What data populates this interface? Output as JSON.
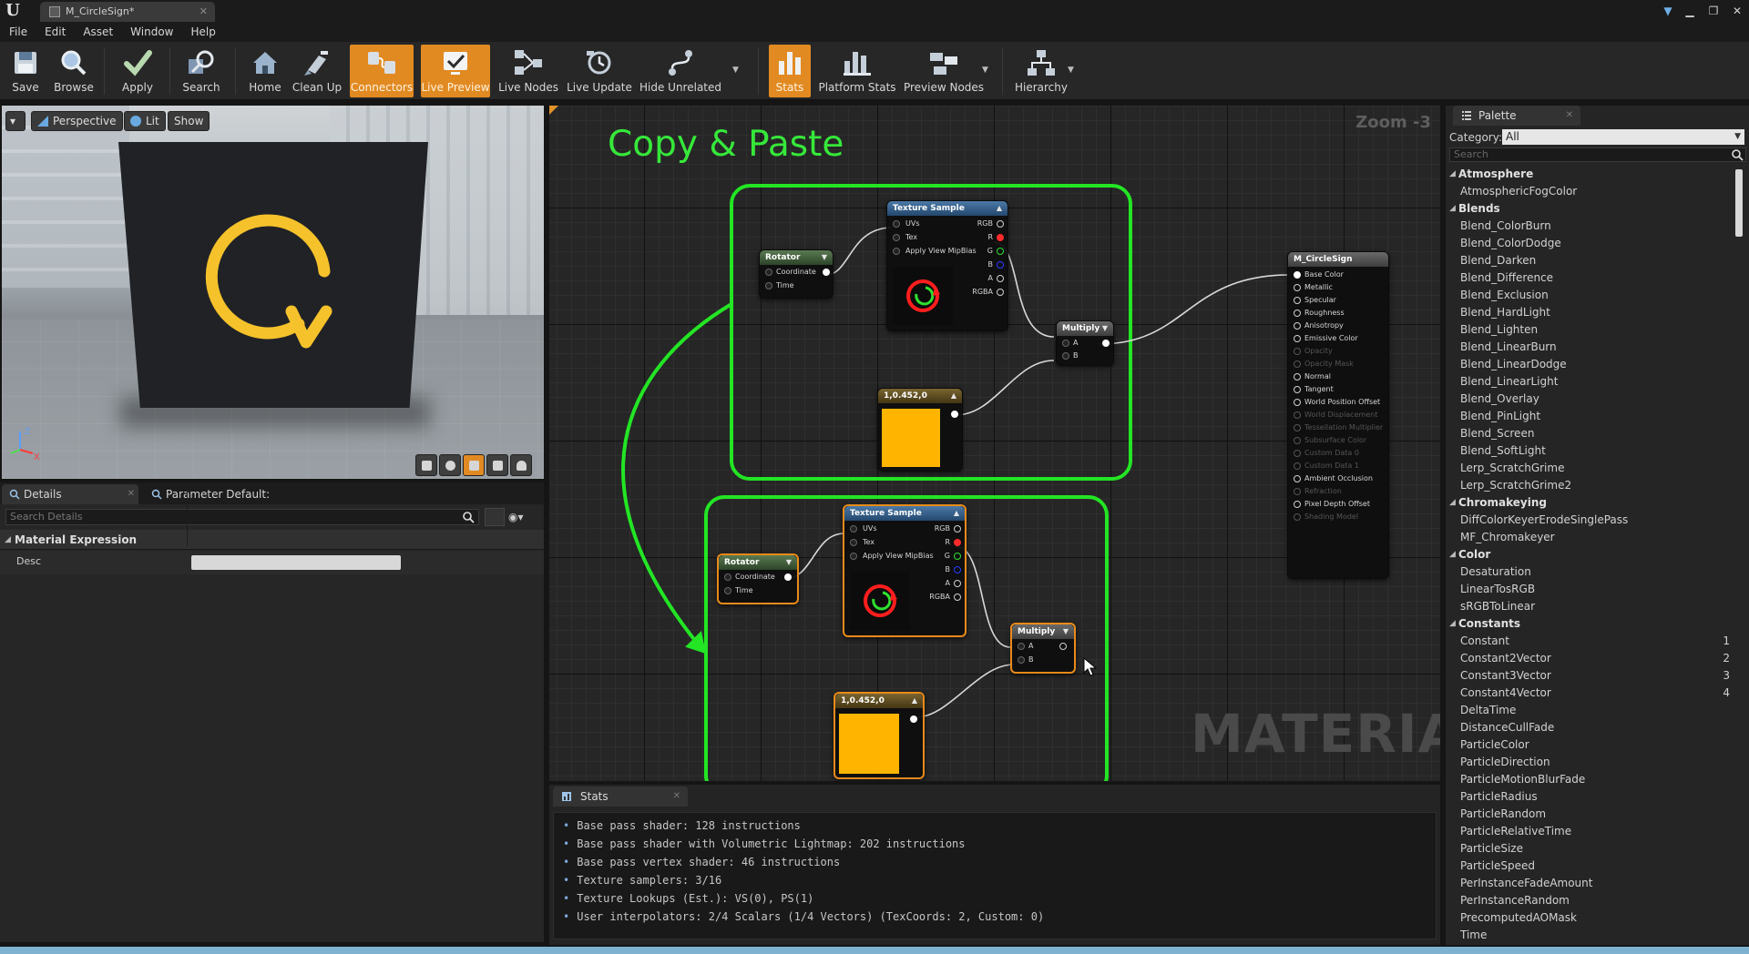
{
  "window": {
    "tab_title": "M_CircleSign*",
    "controls": [
      "minimize",
      "restore",
      "close"
    ]
  },
  "menu": [
    "File",
    "Edit",
    "Asset",
    "Window",
    "Help"
  ],
  "toolbar": {
    "buttons": [
      {
        "label": "Save",
        "icon": "save-icon",
        "active": false
      },
      {
        "label": "Browse",
        "icon": "browse-icon",
        "active": false
      },
      {
        "label": "Apply",
        "icon": "apply-check-icon",
        "active": false
      },
      {
        "label": "Search",
        "icon": "search-icon",
        "active": false
      },
      {
        "label": "Home",
        "icon": "home-icon",
        "active": false
      },
      {
        "label": "Clean Up",
        "icon": "clean-up-icon",
        "active": false
      },
      {
        "label": "Connectors",
        "icon": "connectors-icon",
        "active": true
      },
      {
        "label": "Live Preview",
        "icon": "live-preview-icon",
        "active": true
      },
      {
        "label": "Live Nodes",
        "icon": "live-nodes-icon",
        "active": false
      },
      {
        "label": "Live Update",
        "icon": "live-update-icon",
        "active": false
      },
      {
        "label": "Hide Unrelated",
        "icon": "hide-unrelated-icon",
        "active": false
      },
      {
        "label": "Stats",
        "icon": "stats-icon",
        "active": true
      },
      {
        "label": "Platform Stats",
        "icon": "platform-stats-icon",
        "active": false
      },
      {
        "label": "Preview Nodes",
        "icon": "preview-nodes-icon",
        "active": false
      },
      {
        "label": "Hierarchy",
        "icon": "hierarchy-icon",
        "active": false
      }
    ]
  },
  "viewport": {
    "view_mode": "Perspective",
    "lighting": "Lit",
    "show": "Show",
    "axis_labels": {
      "z": "Z",
      "x": "X"
    }
  },
  "details": {
    "tabs": [
      {
        "label": "Details"
      },
      {
        "label": "Parameter Default:"
      }
    ],
    "search_placeholder": "Search Details",
    "category": "Material Expression",
    "desc_label": "Desc",
    "desc_value": ""
  },
  "graph": {
    "zoom": "Zoom -3",
    "title": "Copy & Paste",
    "watermark": "MATERIAL",
    "texture_sample": {
      "title": "Texture Sample",
      "inputs": [
        "UVs",
        "Tex",
        "Apply View MipBias"
      ],
      "outputs": [
        "RGB",
        "R",
        "G",
        "B",
        "A",
        "RGBA"
      ]
    },
    "rotator": {
      "title": "Rotator",
      "inputs": [
        "Coordinate",
        "Time"
      ]
    },
    "multiply": {
      "title": "Multiply",
      "inputs": [
        "A",
        "B"
      ]
    },
    "constant": {
      "title": "1,0.452,0",
      "color": "#ffb400"
    },
    "result": {
      "title": "M_CircleSign",
      "pins": [
        {
          "label": "Base Color",
          "enabled": true
        },
        {
          "label": "Metallic",
          "enabled": true
        },
        {
          "label": "Specular",
          "enabled": true
        },
        {
          "label": "Roughness",
          "enabled": true
        },
        {
          "label": "Anisotropy",
          "enabled": true
        },
        {
          "label": "Emissive Color",
          "enabled": true
        },
        {
          "label": "Opacity",
          "enabled": false
        },
        {
          "label": "Opacity Mask",
          "enabled": false
        },
        {
          "label": "Normal",
          "enabled": true
        },
        {
          "label": "Tangent",
          "enabled": true
        },
        {
          "label": "World Position Offset",
          "enabled": true
        },
        {
          "label": "World Displacement",
          "enabled": false
        },
        {
          "label": "Tessellation Multiplier",
          "enabled": false
        },
        {
          "label": "Subsurface Color",
          "enabled": false
        },
        {
          "label": "Custom Data 0",
          "enabled": false
        },
        {
          "label": "Custom Data 1",
          "enabled": false
        },
        {
          "label": "Ambient Occlusion",
          "enabled": true
        },
        {
          "label": "Refraction",
          "enabled": false
        },
        {
          "label": "Pixel Depth Offset",
          "enabled": true
        },
        {
          "label": "Shading Model",
          "enabled": false
        }
      ]
    }
  },
  "stats": {
    "tab_label": "Stats",
    "lines": [
      "Base pass shader: 128 instructions",
      "Base pass shader with Volumetric Lightmap: 202 instructions",
      "Base pass vertex shader: 46 instructions",
      "Texture samplers: 3/16",
      "Texture Lookups (Est.): VS(0), PS(1)",
      "User interpolators: 2/4 Scalars (1/4 Vectors) (TexCoords: 2, Custom: 0)"
    ]
  },
  "palette": {
    "tab_label": "Palette",
    "category_label": "Category:",
    "category_value": "All",
    "search_placeholder": "Search",
    "rows": [
      {
        "type": "cat",
        "label": "Atmosphere"
      },
      {
        "type": "item",
        "label": "AtmosphericFogColor"
      },
      {
        "type": "cat",
        "label": "Blends"
      },
      {
        "type": "item",
        "label": "Blend_ColorBurn"
      },
      {
        "type": "item",
        "label": "Blend_ColorDodge"
      },
      {
        "type": "item",
        "label": "Blend_Darken"
      },
      {
        "type": "item",
        "label": "Blend_Difference"
      },
      {
        "type": "item",
        "label": "Blend_Exclusion"
      },
      {
        "type": "item",
        "label": "Blend_HardLight"
      },
      {
        "type": "item",
        "label": "Blend_Lighten"
      },
      {
        "type": "item",
        "label": "Blend_LinearBurn"
      },
      {
        "type": "item",
        "label": "Blend_LinearDodge"
      },
      {
        "type": "item",
        "label": "Blend_LinearLight"
      },
      {
        "type": "item",
        "label": "Blend_Overlay"
      },
      {
        "type": "item",
        "label": "Blend_PinLight"
      },
      {
        "type": "item",
        "label": "Blend_Screen"
      },
      {
        "type": "item",
        "label": "Blend_SoftLight"
      },
      {
        "type": "item",
        "label": "Lerp_ScratchGrime"
      },
      {
        "type": "item",
        "label": "Lerp_ScratchGrime2"
      },
      {
        "type": "cat",
        "label": "Chromakeying"
      },
      {
        "type": "item",
        "label": "DiffColorKeyerErodeSinglePass"
      },
      {
        "type": "item",
        "label": "MF_Chromakeyer"
      },
      {
        "type": "cat",
        "label": "Color"
      },
      {
        "type": "item",
        "label": "Desaturation"
      },
      {
        "type": "item",
        "label": "LinearTosRGB"
      },
      {
        "type": "item",
        "label": "sRGBToLinear"
      },
      {
        "type": "cat",
        "label": "Constants"
      },
      {
        "type": "item",
        "label": "Constant",
        "hotkey": "1"
      },
      {
        "type": "item",
        "label": "Constant2Vector",
        "hotkey": "2"
      },
      {
        "type": "item",
        "label": "Constant3Vector",
        "hotkey": "3"
      },
      {
        "type": "item",
        "label": "Constant4Vector",
        "hotkey": "4"
      },
      {
        "type": "item",
        "label": "DeltaTime"
      },
      {
        "type": "item",
        "label": "DistanceCullFade"
      },
      {
        "type": "item",
        "label": "ParticleColor"
      },
      {
        "type": "item",
        "label": "ParticleDirection"
      },
      {
        "type": "item",
        "label": "ParticleMotionBlurFade"
      },
      {
        "type": "item",
        "label": "ParticleRadius"
      },
      {
        "type": "item",
        "label": "ParticleRandom"
      },
      {
        "type": "item",
        "label": "ParticleRelativeTime"
      },
      {
        "type": "item",
        "label": "ParticleSize"
      },
      {
        "type": "item",
        "label": "ParticleSpeed"
      },
      {
        "type": "item",
        "label": "PerInstanceFadeAmount"
      },
      {
        "type": "item",
        "label": "PerInstanceRandom"
      },
      {
        "type": "item",
        "label": "PrecomputedAOMask"
      },
      {
        "type": "item",
        "label": "Time"
      }
    ]
  },
  "colors": {
    "accent": "#e28a22",
    "highlight_box": "#23e524",
    "title_text": "#36e83a",
    "constant_swatch": "#ffb400",
    "circle_symbol": "#f5c22b"
  }
}
